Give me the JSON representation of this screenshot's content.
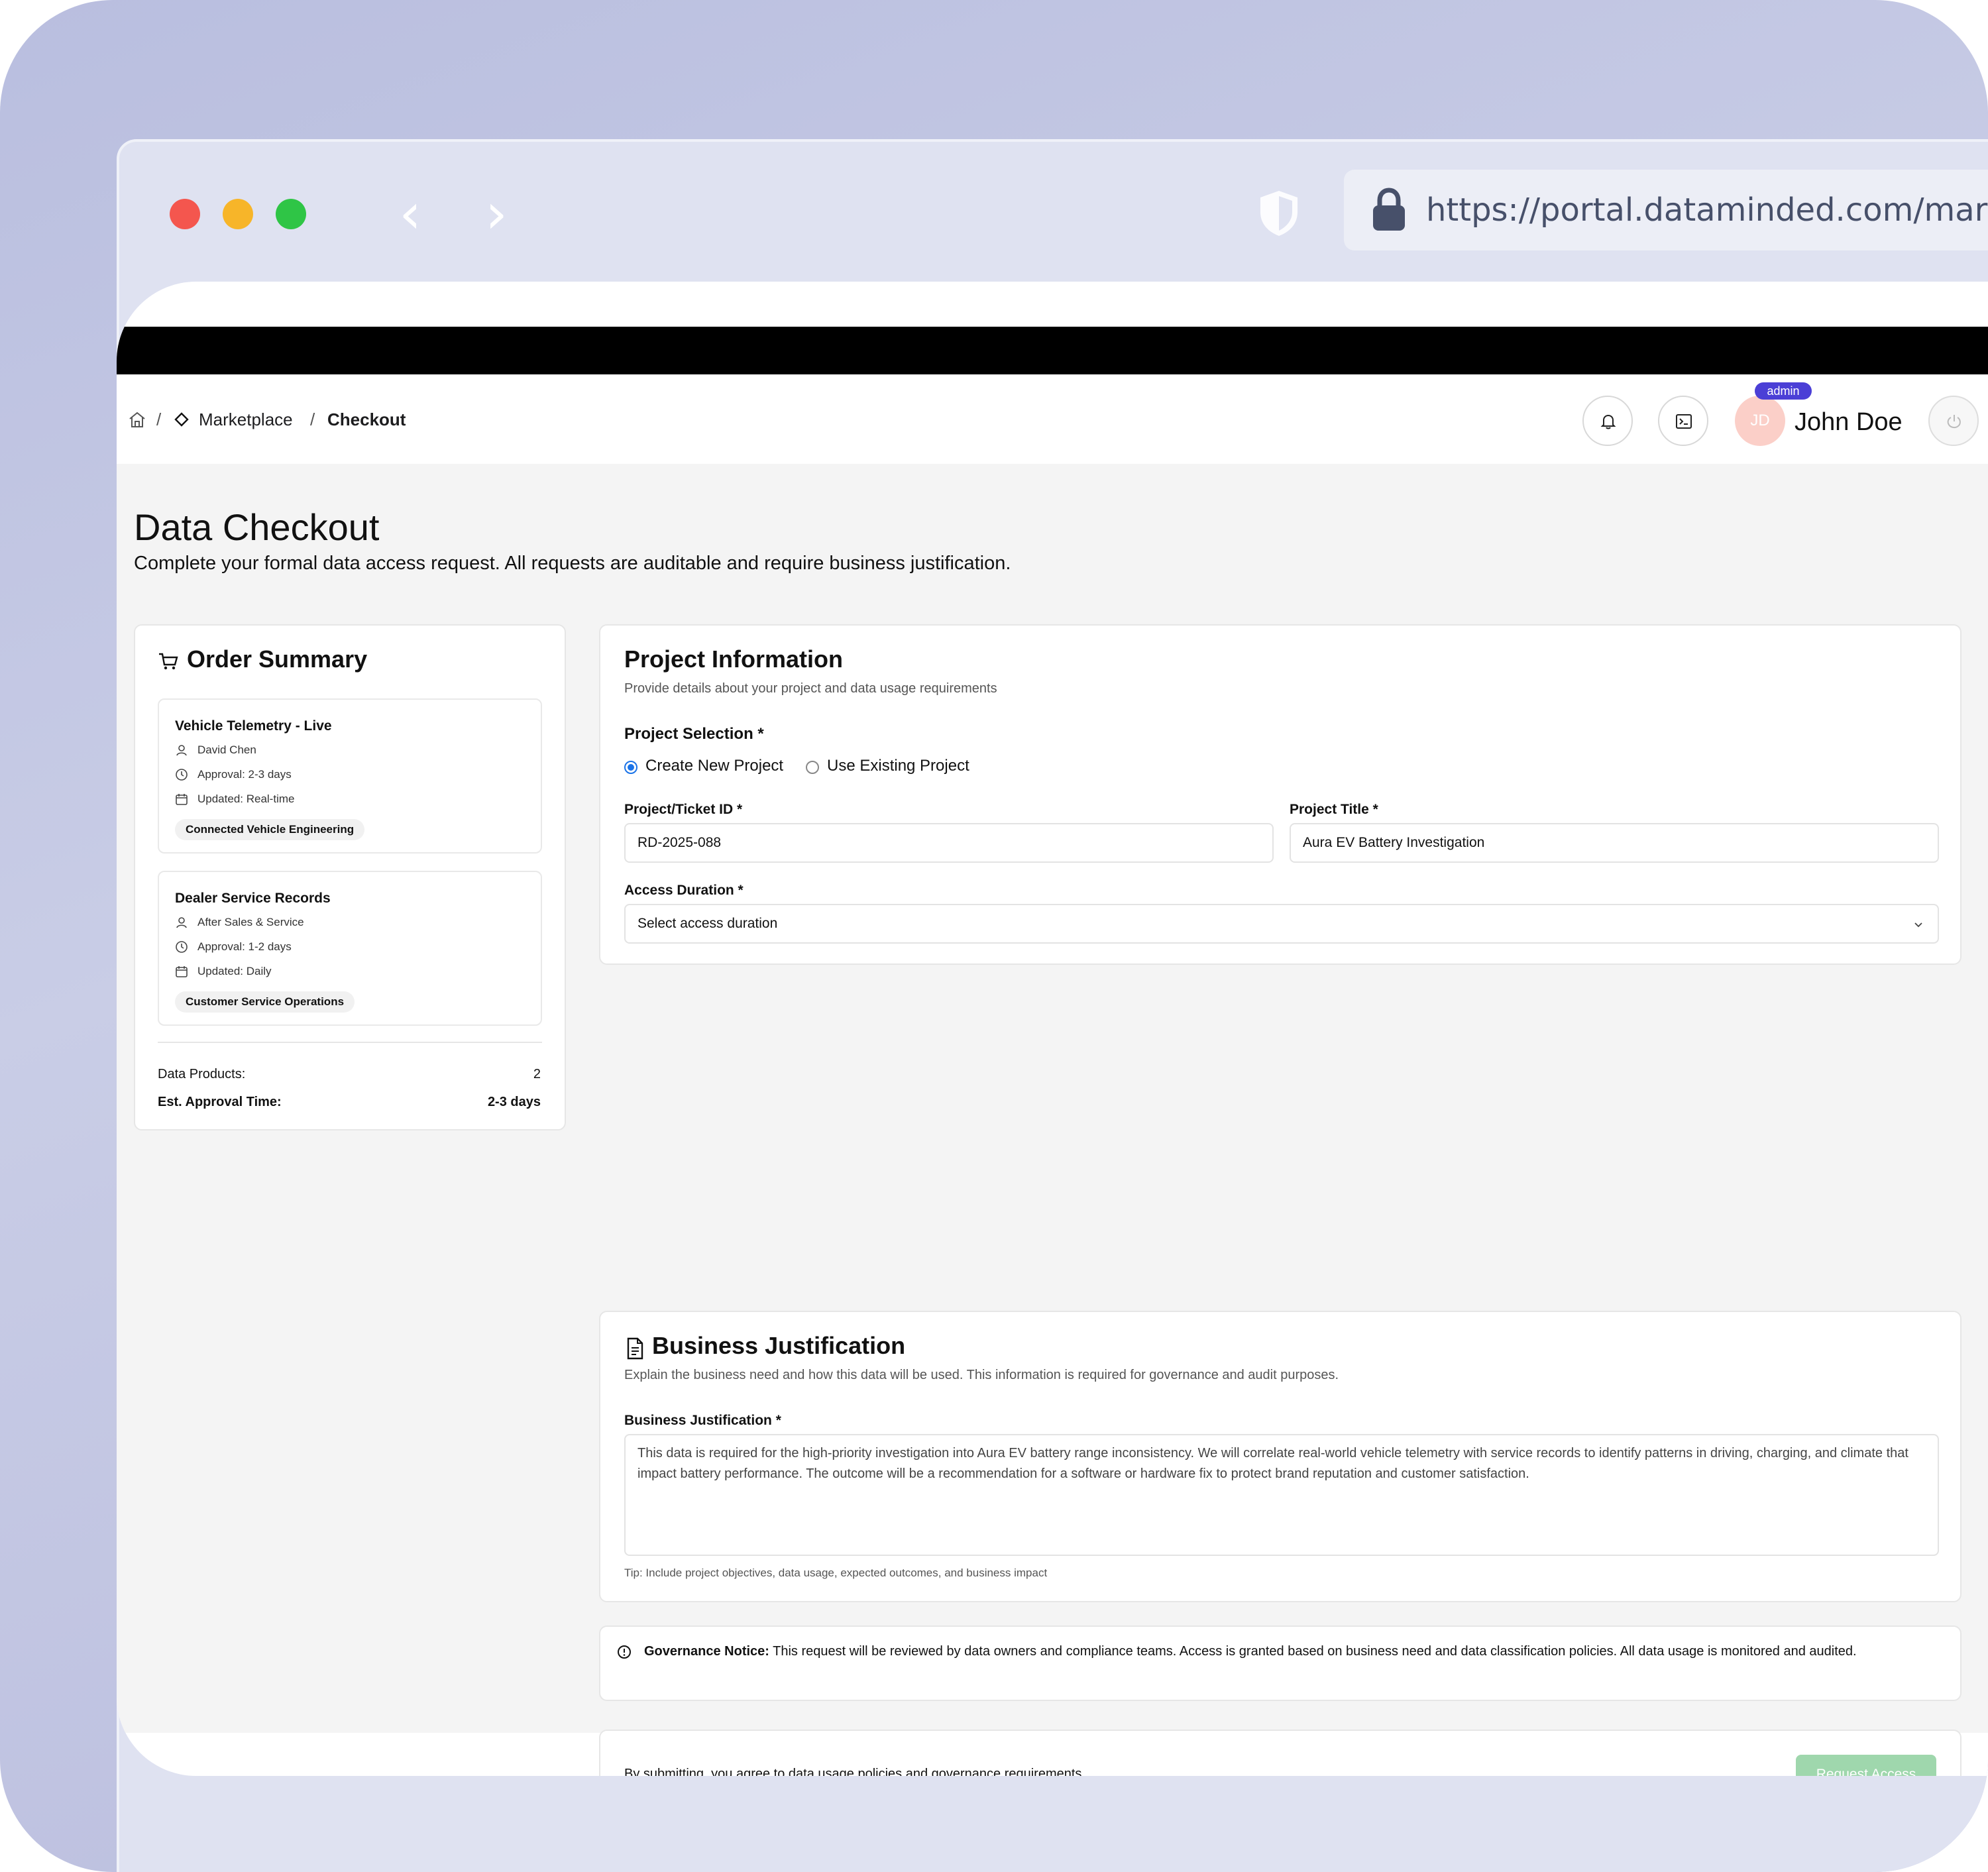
{
  "browser": {
    "url": "https://portal.dataminded.com/marke"
  },
  "breadcrumb": {
    "separator": "/",
    "marketplace": "Marketplace",
    "checkout": "Checkout"
  },
  "user": {
    "initials": "JD",
    "role_badge": "admin",
    "name": "John Doe"
  },
  "page": {
    "title": "Data Checkout",
    "subtitle": "Complete your formal data access request. All requests are auditable and require business justification."
  },
  "order_summary": {
    "title": "Order Summary",
    "products": [
      {
        "name": "Vehicle Telemetry - Live",
        "owner": "David Chen",
        "approval": "Approval: 2-3 days",
        "updated": "Updated: Real-time",
        "domain": "Connected Vehicle Engineering"
      },
      {
        "name": "Dealer Service Records",
        "owner": "After Sales & Service",
        "approval": "Approval: 1-2 days",
        "updated": "Updated: Daily",
        "domain": "Customer Service Operations"
      }
    ],
    "data_products_label": "Data Products:",
    "data_products_value": "2",
    "approval_time_label": "Est. Approval Time:",
    "approval_time_value": "2-3 days"
  },
  "project_info": {
    "title": "Project Information",
    "subtitle": "Provide details about your project and data usage requirements",
    "selection_label": "Project Selection *",
    "option_new": "Create New Project",
    "option_existing": "Use Existing Project",
    "selected_option": "Create New Project",
    "ticket_label": "Project/Ticket ID *",
    "ticket_value": "RD-2025-088",
    "project_title_label": "Project Title *",
    "project_title_value": "Aura EV Battery Investigation",
    "duration_label": "Access Duration *",
    "duration_placeholder": "Select access duration"
  },
  "business_justification": {
    "title": "Business Justification",
    "subtitle": "Explain the business need and how this data will be used. This information is required for governance and audit purposes.",
    "field_label": "Business Justification *",
    "text": "This data is required for the high-priority investigation into Aura EV battery range inconsistency. We will correlate real-world vehicle telemetry with service records to identify patterns in driving, charging, and climate that impact battery performance. The outcome will be a recommendation for a software or hardware fix to protect brand reputation and customer satisfaction.",
    "tip": "Tip: Include project objectives, data usage, expected outcomes, and business impact"
  },
  "notice": {
    "label": "Governance Notice:",
    "text": " This request will be reviewed by data owners and compliance teams. Access is granted based on business need and data classification policies. All data usage is monitored and audited."
  },
  "submit": {
    "text": "By submitting, you agree to data usage policies and governance requirements.",
    "button_label": "Request Access"
  },
  "colors": {
    "accent": "#4b3fd6",
    "radio": "#1a73e8",
    "submit_button": "#9fd7ad",
    "avatar": "#fbcfc8"
  }
}
